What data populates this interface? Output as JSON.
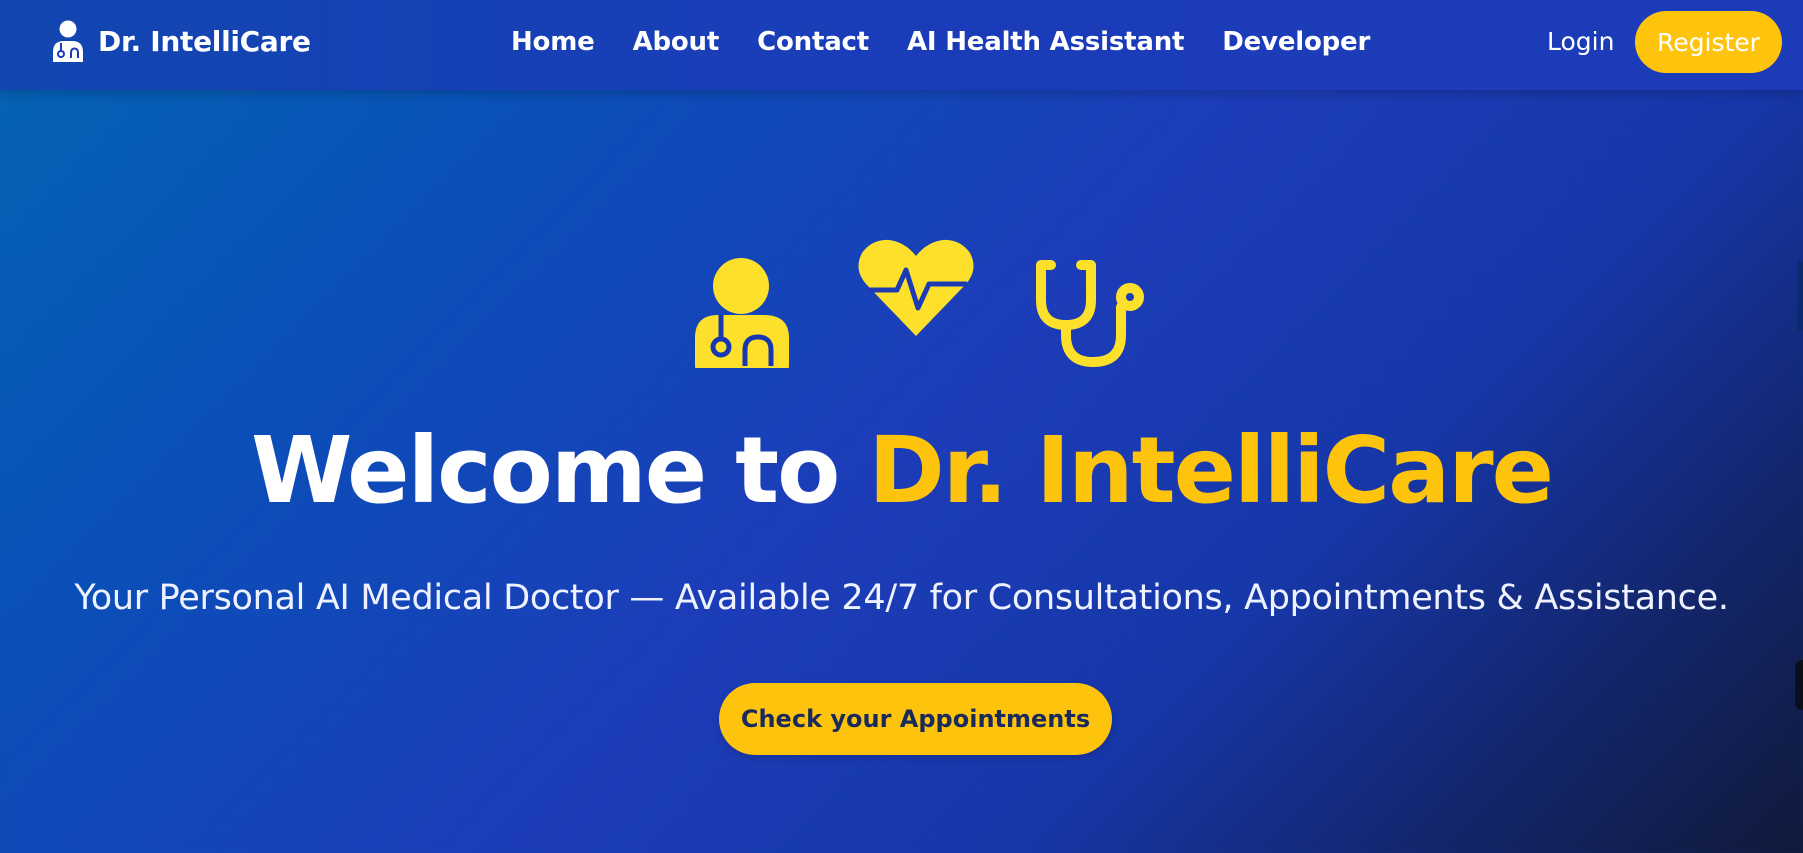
{
  "brand": {
    "name": "Dr. IntelliCare",
    "icon": "doctor-icon"
  },
  "nav": {
    "links": [
      "Home",
      "About",
      "Contact",
      "AI Health Assistant",
      "Developer"
    ],
    "login_label": "Login",
    "register_label": "Register"
  },
  "hero": {
    "icons": [
      "doctor-icon",
      "heartbeat-icon",
      "stethoscope-icon"
    ],
    "headline_prefix": "Welcome to",
    "headline_highlight": "Dr. IntelliCare",
    "subtitle": "Your Personal AI Medical Doctor — Available 24/7 for Consultations, Appointments & Assistance.",
    "cta_label": "Check your Appointments"
  },
  "colors": {
    "accent": "#fec40d",
    "navbar": "#1b3cb9",
    "cta_text": "#1a2a5a"
  }
}
